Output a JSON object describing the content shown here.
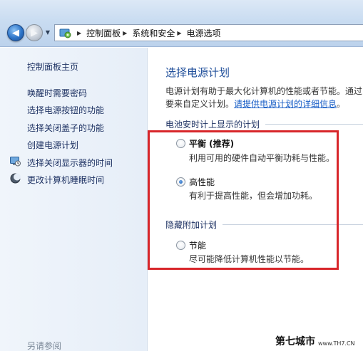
{
  "breadcrumb": {
    "items": [
      "控制面板",
      "系统和安全",
      "电源选项"
    ]
  },
  "sidebar": {
    "home_link": "控制面板主页",
    "links": [
      {
        "label": "唤醒时需要密码",
        "icon": null
      },
      {
        "label": "选择电源按钮的功能",
        "icon": null
      },
      {
        "label": "选择关闭盖子的功能",
        "icon": null
      },
      {
        "label": "创建电源计划",
        "icon": null
      },
      {
        "label": "选择关闭显示器的时间",
        "icon": "display-power-icon"
      },
      {
        "label": "更改计算机睡眠时间",
        "icon": "sleep-moon-icon"
      }
    ],
    "see_also": "另请参阅"
  },
  "main": {
    "title": "选择电源计划",
    "description_line1": "电源计划有助于最大化计算机的性能或者节能。通过",
    "description_line2_prefix": "要来自定义计划。",
    "description_link": "请提供电源计划的详细信息",
    "description_line2_suffix": "。",
    "battery_section_header": "电池安时计上显示的计划",
    "plans": [
      {
        "name": "平衡 (推荐)",
        "description": "利用可用的硬件自动平衡功耗与性能。",
        "selected": false
      },
      {
        "name": "高性能",
        "description": "有利于提高性能，但会增加功耗。",
        "selected": true
      }
    ],
    "hidden_section_header": "隐藏附加计划",
    "hidden_plans": [
      {
        "name": "节能",
        "description": "尽可能降低计算机性能以节能。",
        "selected": false
      }
    ]
  },
  "watermark": {
    "brand": "第七城市",
    "url": "www.TH7.CN"
  },
  "colors": {
    "highlight": "#d8262a",
    "link": "#1a5fc7",
    "title": "#1f4e9a",
    "nav_text": "#1e3263"
  }
}
